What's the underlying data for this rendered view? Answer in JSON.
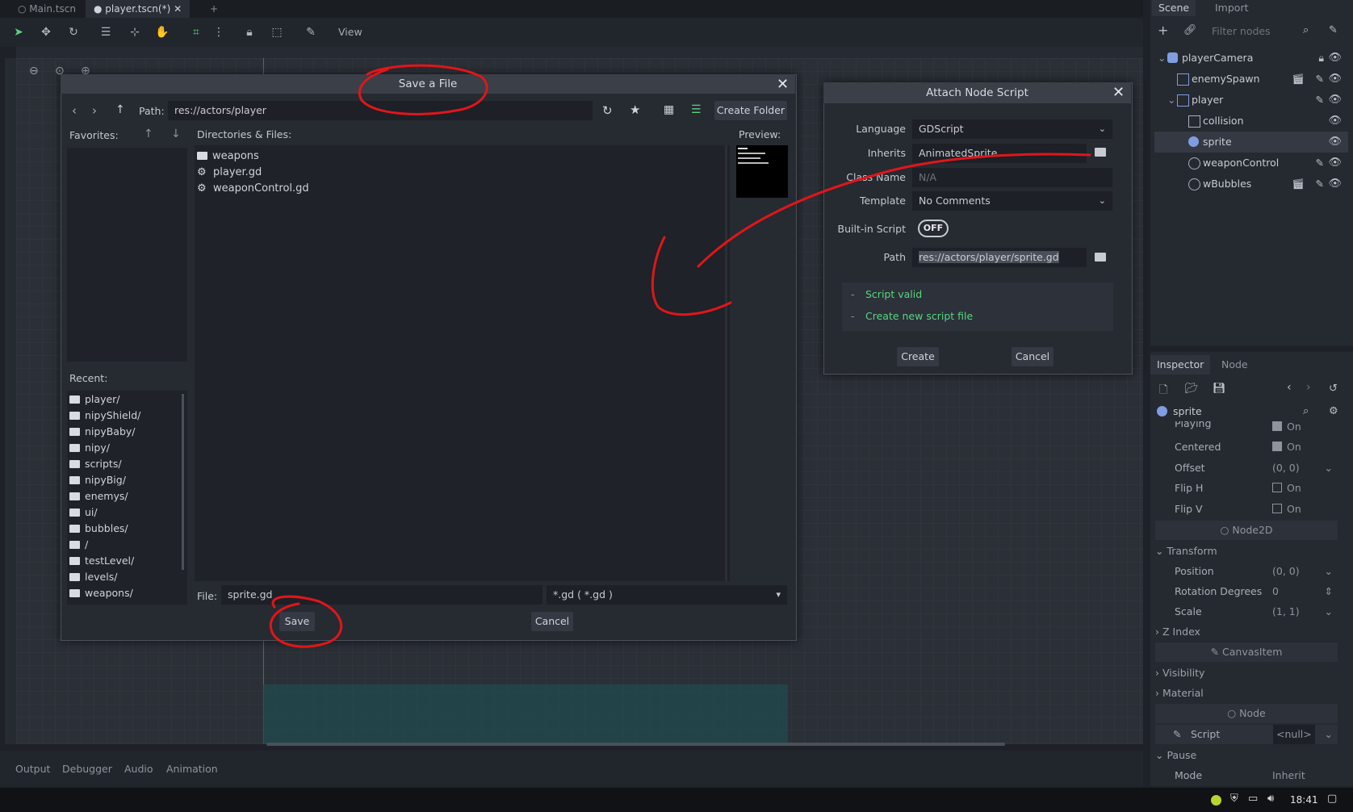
{
  "editor": {
    "tabs": [
      "Main.tscn",
      "player.tscn(*)"
    ],
    "toolbar_view_label": "View"
  },
  "bottom_tabs": [
    "Output",
    "Debugger",
    "Audio",
    "Animation"
  ],
  "scene_dock": {
    "tabs": [
      "Scene",
      "Import"
    ],
    "filter_placeholder": "Filter nodes",
    "nodes": [
      {
        "label": "playerCamera"
      },
      {
        "label": "enemySpawn"
      },
      {
        "label": "player"
      },
      {
        "label": "collision"
      },
      {
        "label": "sprite",
        "selected": true
      },
      {
        "label": "weaponControl"
      },
      {
        "label": "wBubbles"
      }
    ]
  },
  "inspector": {
    "tabs": [
      "Inspector",
      "Node"
    ],
    "object_name": "sprite",
    "props": {
      "playing": {
        "name": "Playing",
        "value": "On"
      },
      "centered": {
        "name": "Centered",
        "value": "On"
      },
      "offset": {
        "name": "Offset",
        "value": "(0, 0)"
      },
      "flip_h": {
        "name": "Flip H",
        "value": "On"
      },
      "flip_v": {
        "name": "Flip V",
        "value": "On"
      },
      "position": {
        "name": "Position",
        "value": "(0, 0)"
      },
      "rotation": {
        "name": "Rotation Degrees",
        "value": "0"
      },
      "scale": {
        "name": "Scale",
        "value": "(1, 1)"
      },
      "script": {
        "name": "Script",
        "value": "<null>"
      },
      "mode": {
        "name": "Mode",
        "value": "Inherit"
      }
    },
    "class_node2d": "Node2D",
    "class_canvasitem": "CanvasItem",
    "class_node": "Node",
    "sections": {
      "transform": "Transform",
      "zindex": "Z Index",
      "visibility": "Visibility",
      "material": "Material",
      "pause": "Pause"
    }
  },
  "save_dialog": {
    "title": "Save a File",
    "path_label": "Path:",
    "path_value": "res://actors/player",
    "create_folder": "Create Folder",
    "favorites_label": "Favorites:",
    "dirs_label": "Directories & Files:",
    "preview_label": "Preview:",
    "files": [
      "weapons",
      "player.gd",
      "weaponControl.gd"
    ],
    "recent_label": "Recent:",
    "recent": [
      "player/",
      "nipyShield/",
      "nipyBaby/",
      "nipy/",
      "scripts/",
      "nipyBig/",
      "enemys/",
      "ui/",
      "bubbles/",
      "/",
      "testLevel/",
      "levels/",
      "weapons/"
    ],
    "file_label": "File:",
    "file_value": "sprite.gd",
    "filter_value": "*.gd ( *.gd )",
    "save_btn": "Save",
    "cancel_btn": "Cancel"
  },
  "attach_dialog": {
    "title": "Attach Node Script",
    "language_label": "Language",
    "language_value": "GDScript",
    "inherits_label": "Inherits",
    "inherits_value": "AnimatedSprite",
    "classname_label": "Class Name",
    "classname_value": "N/A",
    "template_label": "Template",
    "template_value": "No Comments",
    "builtin_label": "Built-in Script",
    "builtin_value": "OFF",
    "path_label": "Path",
    "path_value": "res://actors/player/sprite.gd",
    "msg_valid": "Script valid",
    "msg_create": "Create new script file",
    "msg_dash": "-",
    "create_btn": "Create",
    "cancel_btn": "Cancel"
  },
  "taskbar": {
    "time": "18:41"
  },
  "colors": {
    "annotation_red": "#e0161a",
    "success_green": "#59d483",
    "accent_teal": "#1f4d50"
  }
}
